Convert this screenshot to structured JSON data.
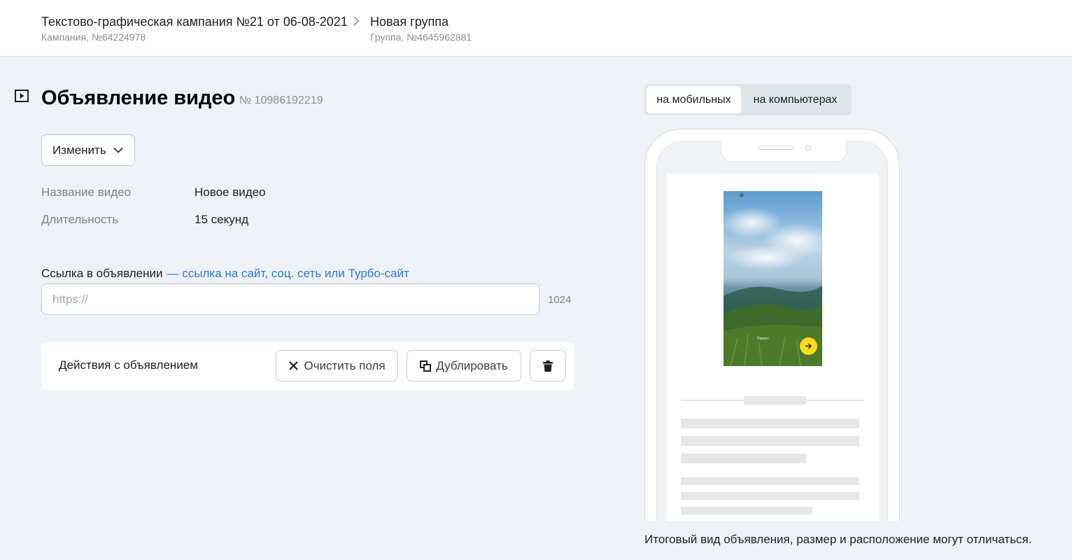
{
  "breadcrumbs": [
    {
      "title": "Текстово-графическая кампания №21 от 06-08-2021",
      "subtitle": "Кампания, №64224978"
    },
    {
      "title": "Новая группа",
      "subtitle": "Группа, №4645962881"
    }
  ],
  "ad": {
    "title": "Объявление видео",
    "number": "№ 10986192219",
    "icon": "video-ad-icon"
  },
  "change_button": {
    "label": "Изменить",
    "icon": "chevron-down-icon"
  },
  "fields": [
    {
      "label": "Название видео",
      "value": "Новое видео"
    },
    {
      "label": "Длительность",
      "value": "15 секунд"
    }
  ],
  "link": {
    "label": "Ссылка в объявлении",
    "hint": "— ссылка на сайт, соц. сеть или Турбо-сайт",
    "placeholder": "https://",
    "value": "",
    "char_limit": "1024"
  },
  "actions": {
    "title": "Действия с объявлением",
    "clear_label": "Очистить поля",
    "duplicate_label": "Дублировать",
    "delete_icon": "trash-icon"
  },
  "preview": {
    "tabs": [
      {
        "label": "на мобильных",
        "active": true
      },
      {
        "label": "на компьютерах",
        "active": false
      }
    ],
    "video_caption": "Привет",
    "disclaimer": "Итоговый вид объявления, размер и расположение могут отличаться."
  },
  "colors": {
    "background": "#eef1f6",
    "link": "#2f78d8",
    "accent_button": "#ffdb1a",
    "muted_text": "#8a8e96"
  }
}
